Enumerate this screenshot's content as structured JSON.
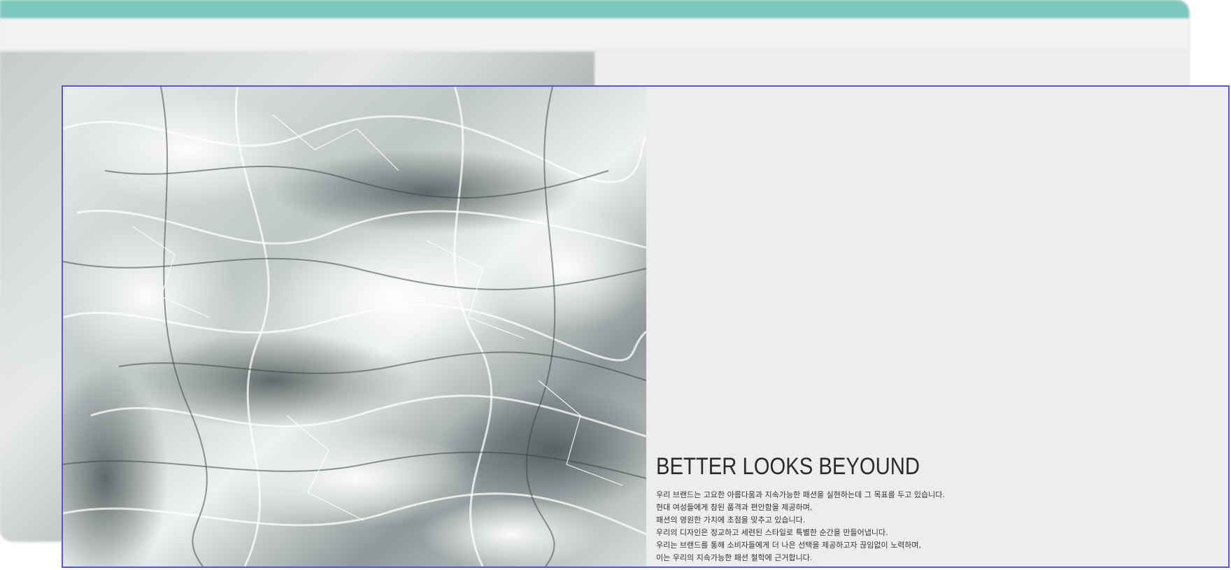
{
  "background_window": {
    "promo_text": "",
    "nav_left": [],
    "logo": "",
    "nav_right": []
  },
  "hero": {
    "image_icon": "ice-photo",
    "headline": "BETTER LOOKS BEYOUND",
    "lines": [
      "우리 브랜드는 고요한 아름다움과 지속가능한 패션을 실현하는데 그 목표를 두고 있습니다.",
      "현대 여성들에게 참된 품격과 편안함을 제공하며,",
      "패션의 영원한 가치에 초점을 맞추고 있습니다.",
      "우리의 디자인은 정교하고 세련된 스타일로 특별한 순간을 만들어냅니다.",
      "우리는 브랜드를 통해 소비자들에게 더 나은 선택을 제공하고자 끊임없이 노력하며,",
      "이는 우리의 지속가능한 패션 철학에 근거합니다."
    ]
  },
  "colors": {
    "promo_bar": "#7cc8bd",
    "panel_border": "#5b54d6",
    "panel_bg": "#ededed",
    "text": "#2b2b2b"
  }
}
